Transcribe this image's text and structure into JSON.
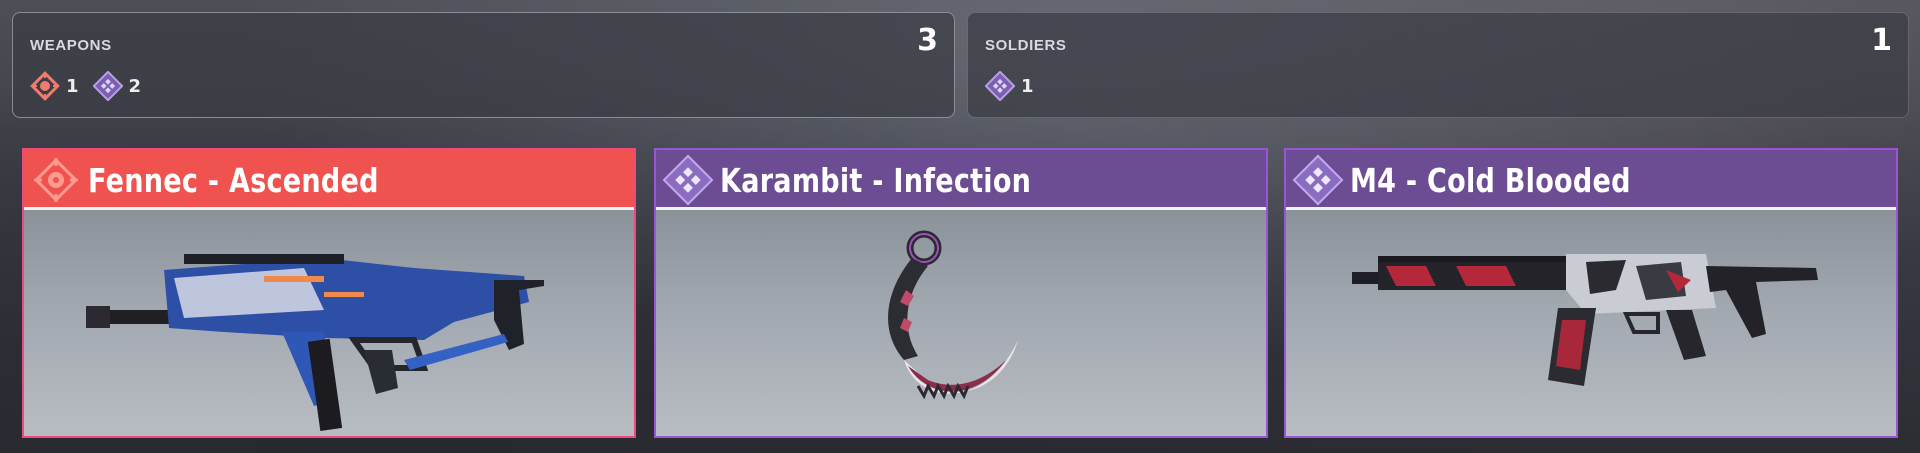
{
  "summary": {
    "weapons": {
      "label": "WEAPONS",
      "total": "3",
      "counts": [
        {
          "icon": "ultra-rarity-icon",
          "value": "1"
        },
        {
          "icon": "legendary-rarity-icon",
          "value": "2"
        }
      ]
    },
    "soldiers": {
      "label": "SOLDIERS",
      "total": "1",
      "counts": [
        {
          "icon": "legendary-rarity-icon",
          "value": "1"
        }
      ]
    }
  },
  "cards": [
    {
      "title": "Fennec - Ascended",
      "rarity": "ultra",
      "accent": "#f0524f",
      "art": "smg-weapon-image"
    },
    {
      "title": "Karambit - Infection",
      "rarity": "legendary",
      "accent": "#6c4d93",
      "art": "karambit-knife-image"
    },
    {
      "title": "M4 - Cold Blooded",
      "rarity": "legendary",
      "accent": "#6c4d93",
      "art": "assault-rifle-image"
    }
  ],
  "colors": {
    "ultra": "#f0524f",
    "legendary": "#6c4d93",
    "legendary_border": "#9a55d6",
    "ultra_border": "#ee4a7d"
  }
}
